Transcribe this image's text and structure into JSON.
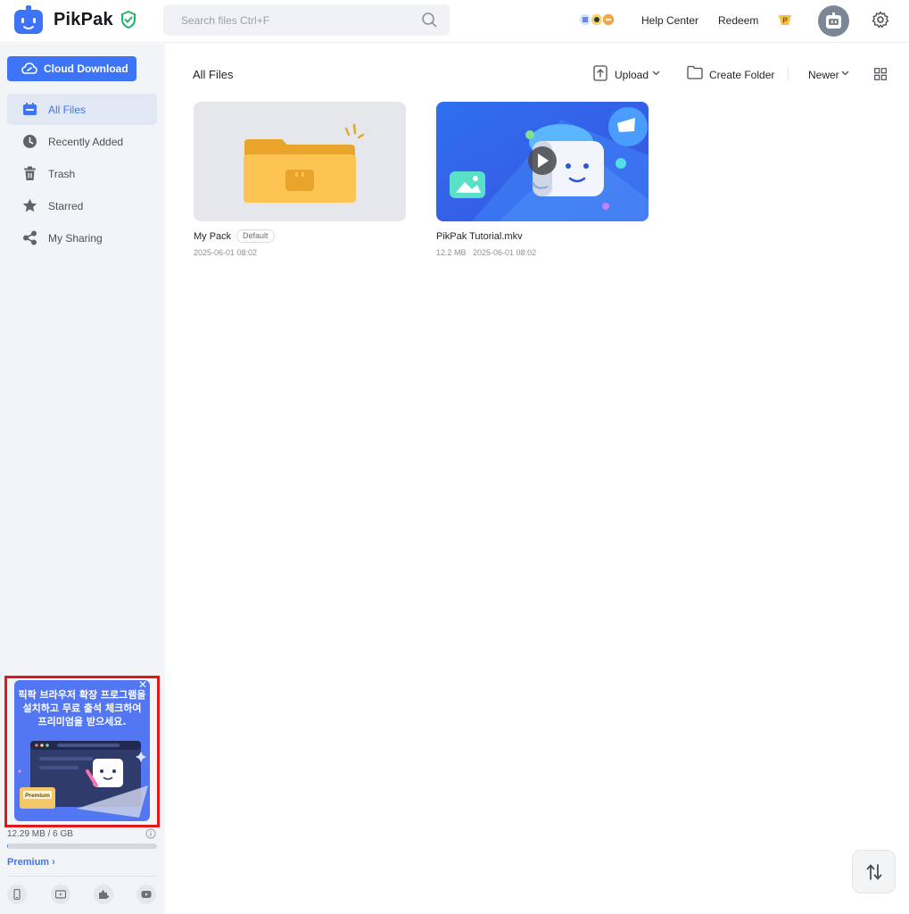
{
  "header": {
    "brand": "PikPak",
    "search_placeholder": "Search files Ctrl+F",
    "help_center": "Help Center",
    "redeem": "Redeem"
  },
  "sidebar": {
    "cloud_download": "Cloud Download",
    "items": [
      {
        "label": "All Files",
        "icon": "folder-icon",
        "active": true
      },
      {
        "label": "Recently Added",
        "icon": "clock-icon",
        "active": false
      },
      {
        "label": "Trash",
        "icon": "trash-icon",
        "active": false
      },
      {
        "label": "Starred",
        "icon": "star-icon",
        "active": false
      },
      {
        "label": "My Sharing",
        "icon": "share-icon",
        "active": false
      }
    ],
    "promo": {
      "text": "픽팍 브라우저 확장 프로그램을 설치하고 무료 출석 체크하여 프리미엄을 받으세요.",
      "badge": "Premium"
    },
    "storage": {
      "text": "12.29 MB / 6 GB",
      "used_fraction": 0.002
    },
    "premium_link": "Premium",
    "bottom_icons": [
      "mobile-icon",
      "tv-icon",
      "extension-icon",
      "youtube-icon"
    ]
  },
  "main": {
    "title": "All Files",
    "toolbar": {
      "upload": "Upload",
      "create_folder": "Create Folder",
      "sort": "Newer"
    },
    "files": [
      {
        "name": "My Pack",
        "badge": "Default",
        "meta": "2025-06-01 08:02",
        "type": "folder"
      },
      {
        "name": "PikPak Tutorial.mkv",
        "meta": "12.2 MB   2025-06-01 08:02",
        "type": "video"
      }
    ]
  },
  "colors": {
    "accent": "#3d73f6",
    "sidebar_bg": "#f3f4f7",
    "highlight": "#e01818"
  }
}
